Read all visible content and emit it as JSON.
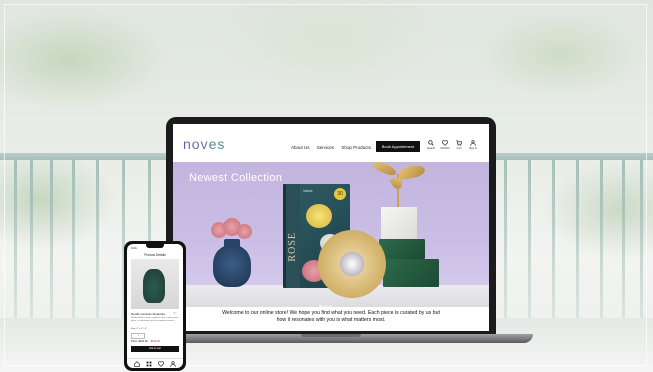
{
  "site": {
    "logo": "noves",
    "nav": [
      "About Us",
      "Services",
      "Shop Products"
    ],
    "cta": "Book Appointment",
    "header_icons": [
      {
        "icon": "search-icon",
        "label": "Search"
      },
      {
        "icon": "heart-icon",
        "label": "Wishlist"
      },
      {
        "icon": "cart-icon",
        "label": "Cart"
      },
      {
        "icon": "user-icon",
        "label": "Sign In"
      }
    ],
    "hero_title": "Newest Collection",
    "book": {
      "title": "ROSE",
      "badge": "30",
      "brand": "Vases"
    },
    "carousel": {
      "count": 3,
      "active": 1
    },
    "welcome_line1": "Welcome to our online store!  We hope you find what you need.  Each piece is curated by us but",
    "welcome_line2": "how it resonates with you is what matters most."
  },
  "phone": {
    "status_time": "9:41",
    "page_title": "Product Details",
    "product_name": "Nordic Ceramic Sculpture",
    "description": "Handcrafted ceramic sculpture with a deep green glaze, a statement piece for modern interiors.",
    "size": "Size: 8\" x 6\" x 5\"",
    "qty": "1",
    "price": "Price: $120.00",
    "old_price": "$150.00",
    "button": "Add to Cart"
  },
  "colors": {
    "brand_purple": "#7b52b3",
    "brand_green": "#3f9f85",
    "hero_bg": "#c2b5de"
  }
}
